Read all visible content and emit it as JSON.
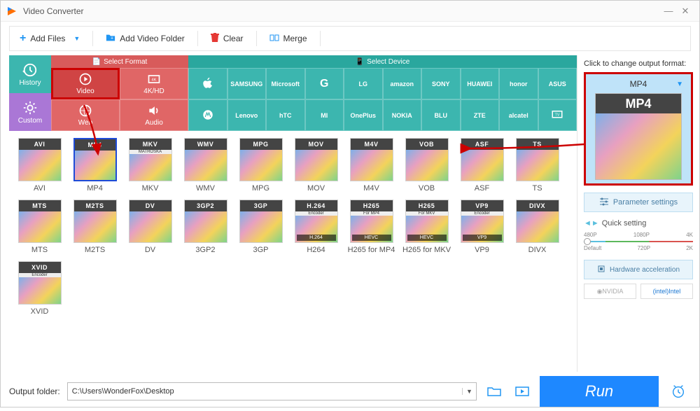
{
  "app": {
    "title": "Video Converter"
  },
  "winControls": {
    "min": "—",
    "close": "✕"
  },
  "toolbar": {
    "add_files": "Add Files",
    "add_folder": "Add Video Folder",
    "clear": "Clear",
    "merge": "Merge"
  },
  "sideTabs": {
    "history": "History",
    "custom": "Custom"
  },
  "catHeads": {
    "format": "Select Format",
    "device": "Select Device"
  },
  "formatCats": [
    {
      "id": "video",
      "label": "Video",
      "icon": "play"
    },
    {
      "id": "4khd",
      "label": "4K/HD",
      "icon": "4k"
    },
    {
      "id": "web",
      "label": "Web",
      "icon": "globe"
    },
    {
      "id": "audio",
      "label": "Audio",
      "icon": "speaker"
    }
  ],
  "deviceBrands": [
    "Apple",
    "SAMSUNG",
    "Microsoft",
    "G",
    "LG",
    "amazon",
    "SONY",
    "HUAWEI",
    "honor",
    "ASUS",
    "moto",
    "Lenovo",
    "hTC",
    "MI",
    "OnePlus",
    "NOKIA",
    "BLU",
    "ZTE",
    "alcatel",
    "TV"
  ],
  "formats": [
    {
      "code": "AVI",
      "label": "AVI"
    },
    {
      "code": "MP4",
      "label": "MP4",
      "selected": true
    },
    {
      "code": "MKV",
      "label": "MKV",
      "sub": "MATROSKA"
    },
    {
      "code": "WMV",
      "label": "WMV"
    },
    {
      "code": "MPG",
      "label": "MPG"
    },
    {
      "code": "MOV",
      "label": "MOV"
    },
    {
      "code": "M4V",
      "label": "M4V"
    },
    {
      "code": "VOB",
      "label": "VOB"
    },
    {
      "code": "ASF",
      "label": "ASF"
    },
    {
      "code": "TS",
      "label": "TS"
    },
    {
      "code": "MTS",
      "label": "MTS"
    },
    {
      "code": "M2TS",
      "label": "M2TS"
    },
    {
      "code": "DV",
      "label": "DV"
    },
    {
      "code": "3GP2",
      "label": "3GP2"
    },
    {
      "code": "3GP",
      "label": "3GP"
    },
    {
      "code": "H.264",
      "label": "H264",
      "sub": "Encoder",
      "tag": "H.264"
    },
    {
      "code": "H265",
      "label": "H265 for MP4",
      "sub": "For MP4",
      "tag": "HEVC"
    },
    {
      "code": "H265",
      "label": "H265 for MKV",
      "sub": "For MKV",
      "tag": "HEVC"
    },
    {
      "code": "VP9",
      "label": "VP9",
      "sub": "Encoder",
      "tag": "VP9"
    },
    {
      "code": "DIVX",
      "label": "DIVX"
    },
    {
      "code": "XVID",
      "label": "XVID",
      "sub": "Encoder"
    }
  ],
  "output": {
    "hint": "Click to change output format:",
    "current": "MP4",
    "thumb_code": "MP4",
    "param_btn": "Parameter settings",
    "quick_title": "Quick setting",
    "ticks_top": [
      "480P",
      "1080P",
      "4K"
    ],
    "ticks_bottom": [
      "Default",
      "720P",
      "2K"
    ],
    "hw_btn": "Hardware acceleration",
    "gpu_nvidia": "NVIDIA",
    "gpu_intel": "Intel"
  },
  "footer": {
    "label": "Output folder:",
    "path": "C:\\Users\\WonderFox\\Desktop",
    "run": "Run"
  }
}
